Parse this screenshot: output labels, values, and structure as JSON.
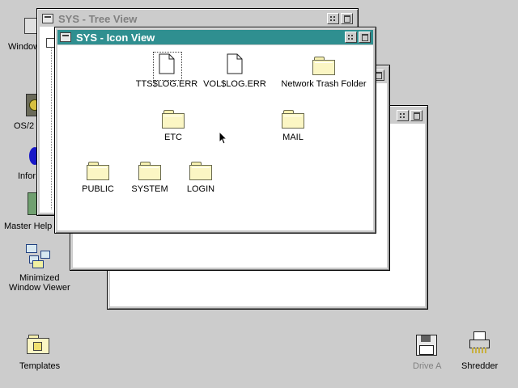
{
  "desktop": {
    "left_icons": [
      {
        "label": "Window"
      },
      {
        "label": "OS/2"
      },
      {
        "label": "Infor"
      },
      {
        "label": "Master Help"
      },
      {
        "label_line1": "Minimized",
        "label_line2": "Window Viewer"
      }
    ],
    "bottom_icons": {
      "templates": "Templates",
      "drive_a": "Drive A",
      "shredder": "Shredder"
    }
  },
  "windows": {
    "tree_view": {
      "title": "SYS - Tree View"
    },
    "icon_view": {
      "title": "SYS - Icon View",
      "items": [
        {
          "label": "TTS$LOG.ERR",
          "icon": "document-icon"
        },
        {
          "label": "VOL$LOG.ERR",
          "icon": "document-icon"
        },
        {
          "label": "Network Trash Folder",
          "icon": "folder-icon"
        },
        {
          "label": "ETC",
          "icon": "folder-icon"
        },
        {
          "label": "MAIL",
          "icon": "folder-icon"
        },
        {
          "label": "PUBLIC",
          "icon": "folder-icon"
        },
        {
          "label": "SYSTEM",
          "icon": "folder-icon"
        },
        {
          "label": "LOGIN",
          "icon": "folder-icon"
        }
      ]
    }
  },
  "colors": {
    "desktop": "#cccccc",
    "active_title": "#2f8f90",
    "folder": "#fbf6c4"
  }
}
